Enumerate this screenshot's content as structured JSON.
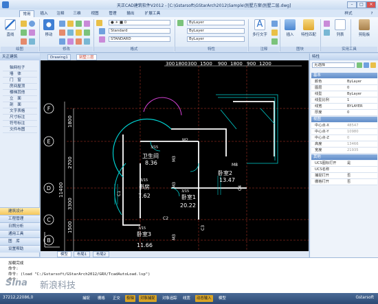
{
  "window": {
    "title": "天正CAD建筑软件V2012 - [C:\\Gstarsoft\\GStarArch2012\\Sample\\别墅方案\\别墅二层.dwg]",
    "style_label": "样式",
    "help": "?"
  },
  "ribbon": {
    "tabs": [
      "常用",
      "插入",
      "注释",
      "三维",
      "视图",
      "管理",
      "输出",
      "扩展工具"
    ],
    "groups": [
      "绘图",
      "修改",
      "格式",
      "特性",
      "注释",
      "图块",
      "实用工具"
    ],
    "buttons": {
      "line": "直线",
      "move": "移动",
      "layer": "图层",
      "mtext": "多行文字",
      "insert": "插入",
      "properties": "特性匹配",
      "clipboard": "剪贴板",
      "group": "列表"
    },
    "combos": {
      "layer_color": "ByLayer",
      "linetype": "ByLayer",
      "lineweight": "ByLayer",
      "text_style": "Standard",
      "dim_style": "STANDARD"
    }
  },
  "left_panel": {
    "title": "天正建筑",
    "items": [
      "轴网柱子",
      "墙　体",
      "门　窗",
      "房间屋顶",
      "楼梯其他",
      "立　面",
      "剖　面",
      "文字表格",
      "尺寸标注",
      "符号标注",
      "文件布图"
    ],
    "bottom": [
      "建筑设计",
      "工程管理",
      "日照分析",
      "通用工具",
      "图　库",
      "设置帮助"
    ]
  },
  "drawing_tabs": [
    "Drawing1",
    "别墅二层"
  ],
  "layout_tabs": [
    "模型",
    "布局1",
    "布局2"
  ],
  "canvas": {
    "dims_top": [
      "300",
      "1800",
      "300",
      "1500",
      "900",
      "1800",
      "900",
      "1200"
    ],
    "dims_left": [
      "1800",
      "2700",
      "11400",
      "3300",
      "1500"
    ],
    "axis_labels": [
      "F",
      "E",
      "D",
      "C",
      "B"
    ],
    "rooms": [
      {
        "name": "卫生间",
        "area": "8.36",
        "num": "3/15"
      },
      {
        "name": "卧室2",
        "area": "13.47",
        "num": ""
      },
      {
        "name": "书房",
        "area": "7.62",
        "num": "3/15"
      },
      {
        "name": "卧室1",
        "area": "20.22",
        "num": "3/15"
      },
      {
        "name": "卧室3",
        "area": "11.66",
        "num": "3/15"
      }
    ],
    "tags": [
      "M2",
      "M3",
      "M8",
      "C4",
      "M3",
      "C1",
      "C2",
      "C3",
      "M3"
    ]
  },
  "prop_panel": {
    "title": "特性",
    "selector": "无选择",
    "sections": [
      "基本",
      "视图",
      "其他"
    ],
    "basic": [
      [
        "颜色",
        "ByLayer"
      ],
      [
        "图层",
        "0"
      ],
      [
        "线型",
        "ByLayer"
      ],
      [
        "线型比例",
        "1"
      ],
      [
        "线宽",
        "BYLAYER"
      ],
      [
        "厚度",
        "0"
      ]
    ],
    "view": [
      [
        "中心点-X",
        "48547"
      ],
      [
        "中心点-Y",
        "10980"
      ],
      [
        "中心点-Z",
        "0"
      ],
      [
        "高度",
        "13466"
      ],
      [
        "宽度",
        "21935"
      ]
    ],
    "misc": [
      [
        "UCS图标打开",
        "是"
      ],
      [
        "UCS名称",
        ""
      ],
      [
        "捕捉打开",
        "否"
      ],
      [
        "栅格打开",
        "否"
      ]
    ]
  },
  "command": {
    "lines": [
      "加载完成",
      "命令:",
      "命令: (load \"C:/Gstarsoft/GStarArch2012/GRX/TcadAutoLoad.lsp\")",
      "命令:"
    ]
  },
  "watermark": {
    "logo": "Sina",
    "text": "新浪科技"
  },
  "status": {
    "coords": "37212,22086,0",
    "buttons": [
      "捕捉",
      "栅格",
      "正交",
      "极轴",
      "对象捕捉",
      "对象追踪",
      "线宽",
      "动态输入",
      "模型"
    ],
    "active": [
      3,
      4,
      7
    ],
    "brand": "Gstarsoft"
  }
}
